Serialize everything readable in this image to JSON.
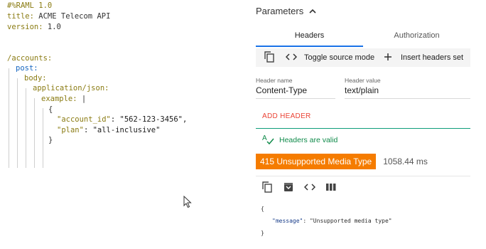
{
  "editor": {
    "lines": {
      "l1": "#%RAML 1.0",
      "l2_key": "title:",
      "l2_val": " ACME Telecom API",
      "l3_key": "version:",
      "l3_val": " 1.0",
      "l4": "/accounts:",
      "l5": "post:",
      "l6": "body:",
      "l7": "application/json:",
      "l8_key": "example:",
      "l8_val": " |",
      "l9": "{",
      "l10_key": "\"account_id\"",
      "l10_val": ": \"562-123-3456\",",
      "l11_key": "\"plan\"",
      "l11_val": ": \"all-inclusive\"",
      "l12": "}"
    }
  },
  "panel": {
    "params_title": "Parameters",
    "tabs": [
      "Headers",
      "Authorization"
    ],
    "toolbar": {
      "toggle_label": "Toggle source mode",
      "insert_label": "Insert headers set"
    },
    "header_name_label": "Header name",
    "header_name_value": "Content-Type",
    "header_value_label": "Header value",
    "header_value_value": "text/plain",
    "add_header": "ADD HEADER",
    "valid_text": "Headers are valid",
    "status": "415 Unsupported Media Type",
    "time": "1058.44 ms",
    "response": {
      "open": "{",
      "key": "\"message\"",
      "val": ": \"Unsupported media type\"",
      "close": "}"
    }
  },
  "colors": {
    "accent_blue": "#1a73e8",
    "status_orange": "#f57c00",
    "valid_green": "#0f8a4a",
    "add_red": "#ea4335"
  }
}
